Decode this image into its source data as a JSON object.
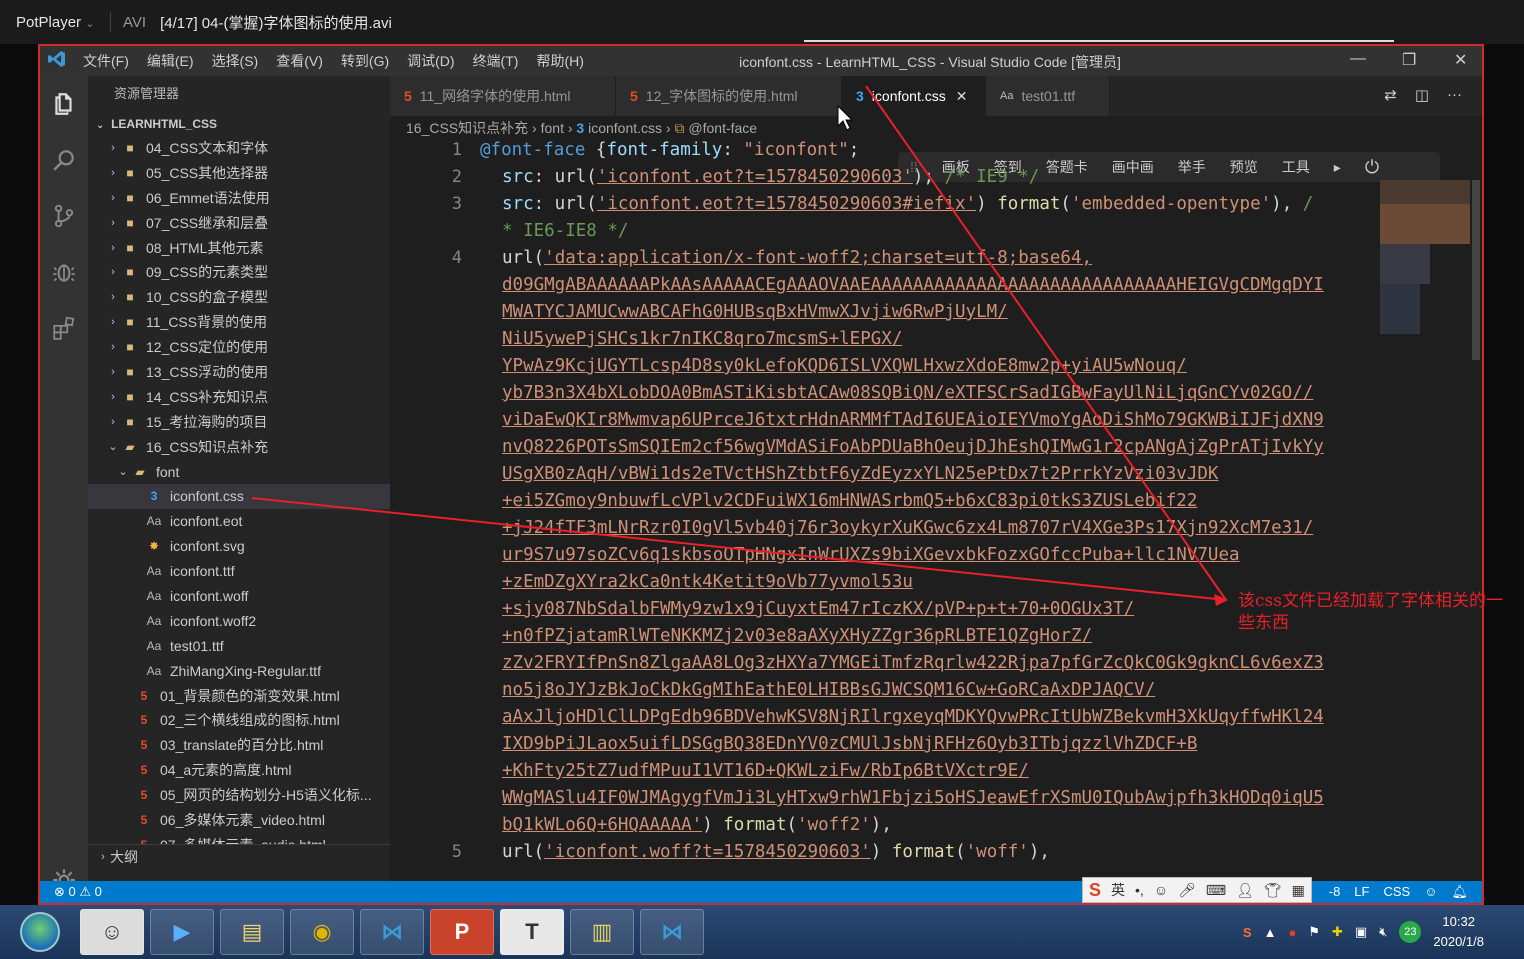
{
  "player": {
    "name": "PotPlayer",
    "format": "AVI",
    "title": "[4/17] 04-(掌握)字体图标的使用.avi"
  },
  "window": {
    "menu": [
      "文件(F)",
      "编辑(E)",
      "选择(S)",
      "查看(V)",
      "转到(G)",
      "调试(D)",
      "终端(T)",
      "帮助(H)"
    ],
    "title": "iconfont.css - LearnHTML_CSS - Visual Studio Code [管理员]"
  },
  "sidebar": {
    "header": "资源管理器",
    "section": "LEARNHTML_CSS",
    "items": [
      {
        "label": "04_CSS文本和字体",
        "type": "folder"
      },
      {
        "label": "05_CSS其他选择器",
        "type": "folder"
      },
      {
        "label": "06_Emmet语法使用",
        "type": "folder"
      },
      {
        "label": "07_CSS继承和层叠",
        "type": "folder"
      },
      {
        "label": "08_HTML其他元素",
        "type": "folder"
      },
      {
        "label": "09_CSS的元素类型",
        "type": "folder"
      },
      {
        "label": "10_CSS的盒子模型",
        "type": "folder"
      },
      {
        "label": "11_CSS背景的使用",
        "type": "folder"
      },
      {
        "label": "12_CSS定位的使用",
        "type": "folder"
      },
      {
        "label": "13_CSS浮动的使用",
        "type": "folder"
      },
      {
        "label": "14_CSS补充知识点",
        "type": "folder"
      },
      {
        "label": "15_考拉海购的项目",
        "type": "folder"
      },
      {
        "label": "16_CSS知识点补充",
        "type": "folder-open"
      },
      {
        "label": "font",
        "type": "subfolder"
      },
      {
        "label": "iconfont.css",
        "type": "css",
        "selected": true
      },
      {
        "label": "iconfont.eot",
        "type": "font"
      },
      {
        "label": "iconfont.svg",
        "type": "svg"
      },
      {
        "label": "iconfont.ttf",
        "type": "font"
      },
      {
        "label": "iconfont.woff",
        "type": "font"
      },
      {
        "label": "iconfont.woff2",
        "type": "font"
      },
      {
        "label": "test01.ttf",
        "type": "font"
      },
      {
        "label": "ZhiMangXing-Regular.ttf",
        "type": "font"
      },
      {
        "label": "01_背景颜色的渐变效果.html",
        "type": "html"
      },
      {
        "label": "02_三个横线组成的图标.html",
        "type": "html"
      },
      {
        "label": "03_translate的百分比.html",
        "type": "html"
      },
      {
        "label": "04_a元素的高度.html",
        "type": "html"
      },
      {
        "label": "05_网页的结构划分-H5语义化标...",
        "type": "html"
      },
      {
        "label": "06_多媒体元素_video.html",
        "type": "html"
      },
      {
        "label": "07_多媒体元素_audio.html",
        "type": "html"
      }
    ],
    "outline": "大纲"
  },
  "tabs": [
    {
      "label": "11_网络字体的使用.html",
      "icon": "html5-icon"
    },
    {
      "label": "12_字体图标的使用.html",
      "icon": "html5-icon"
    },
    {
      "label": "iconfont.css",
      "icon": "css3-icon",
      "active": true
    },
    {
      "label": "test01.ttf",
      "icon": "font-icon"
    }
  ],
  "breadcrumb": {
    "folder": "16_CSS知识点补充",
    "sub": "font",
    "file": "iconfont.css",
    "symbol": "@font-face"
  },
  "floating_toolbar": [
    "画板",
    "签到",
    "答题卡",
    "画中画",
    "举手",
    "预览",
    "工具"
  ],
  "code": {
    "line1": {
      "num": "1",
      "at": "@font-face",
      "brace": " {",
      "prop": "font-family",
      "colon": ": ",
      "val": "\"iconfont\"",
      "semi": ";"
    },
    "line2": {
      "num": "2",
      "prop": "src",
      "pre": ": url(",
      "str": "'iconfont.eot?t=1578450290603'",
      "post": ");",
      "cmt": " /* IE9 */"
    },
    "line3": {
      "num": "3",
      "prop": "src",
      "pre": ": url(",
      "str": "'iconfont.eot?t=1578450290603#iefix'",
      "post": ") ",
      "fn": "format",
      "fstr": "'embedded-opentype'",
      "tail": "),",
      "cmt": " /"
    },
    "line3b": "* IE6-IE8 */",
    "line4": {
      "num": "4",
      "pre": "url(",
      "str": "'data:application/x-font-woff2;charset=utf-8;base64,"
    },
    "base64": [
      "d09GMgABAAAAAAPkAAsAAAAACEgAAAOVAAEAAAAAAAAAAAAAAAAAAAAAAAAAAAAAHEIGVgCDMgqDYI",
      "MWATYCJAMUCwwABCAFhG0HUBsqBxHVmwXJvjiw6RwPjUyLM/",
      "NiU5ywePjSHCs1kr7nIKC8qro7mcsmS+lEPGX/",
      "YPwAz9KcjUGYTLcsp4D8sy0kLefoKQD6ISLVXQWLHxwzXdoE8mw2p+yiAU5wNouq/",
      "yb7B3n3X4bXLobDOA0BmASTiKisbtACAw08SQBiQN/eXTFSCrSadIGBwFayUlNiLjqGnCYv02GO//",
      "viDaEwQKIr8Mwmvap6UPrceJ6txtrHdnARMMfTAdI6UEAioIEYVmoYgAoDiShMo79GKWBiIJFjdXN9",
      "nvQ8226POTsSmSQIEm2cf56wgVMdASiFoAbPDUaBhOeujDJhEshQIMwG1r2cpANgAjZgPrATjIvkYy",
      "USgXB0zAqH/vBWi1ds2eTVctHShZtbtF6yZdEyzxYLN25ePtDx7t2PrrkYzVzi03vJDK",
      "+ei5ZGmoy9nbuwfLcVPlv2CDFuiWX16mHNWASrbmQ5+b6xC83pi0tkS3ZUSLebif22",
      "+jJ24fTF3mLNrRzr0I0gVl5vb40j76r3oykyrXuKGwc6zx4Lm8707rV4XGe3Ps17Xjn92XcM7e31/",
      "ur9S7u97soZCv6q1skbsoOTpHNgxInWrUXZs9biXGevxbkFozxGOfccPuba+llc1NV7Uea",
      "+zEmDZgXYra2kCa0ntk4Ketit9oVb77yvmol53u",
      "+sjy087NbSdalbFWMy9zw1x9jCuyxtEm47rIczKX/pVP+p+t+70+0OGUx3T/",
      "+n0fPZjatamRlWTeNKKMZj2v03e8aAXyXHyZZgr36pRLBTE1QZgHorZ/",
      "zZv2FRYIfPnSn8ZlgaAA8LOg3zHXYa7YMGEiTmfzRqrlw422Rjpa7pfGrZcQkC0Gk9gknCL6v6exZ3",
      "no5j8oJYJzBkJoCkDkGgMIhEathE0LHIBBsGJWCSQM16Cw+GoRCaAxDPJAQCV/",
      "aAxJljoHDlClLDPgEdb96BDVehwKSV8NjRIlrgxeyqMDKYQvwPRcItUbWZBekvmH3XkUqyffwHKl24",
      "IXD9bPiJLaox5uifLDSGgBQ38EDnYV0zCMUlJsbNjRFHz6Oyb3ITbjqzzlVhZDCF+B",
      "+KhFty25tZ7udfMPuuI1VT16D+QKWLziFw/RbIp6BtVXctr9E/",
      "WWgMASlu4IF0WJMAgygfVmJi3LyHTxw9rhW1Fbjzi5oHSJeawEfrXSmU0IQubAwjpfh3kHODq0iqU5",
      "bQ1kWLo6Q+6HQAAAAA'"
    ],
    "line4end": {
      "post": ") ",
      "fn": "format",
      "fstr": "'woff2'",
      "tail": "),"
    },
    "line5": {
      "num": "5",
      "pre": "url(",
      "str": "'iconfont.woff?t=1578450290603'",
      "post": ") ",
      "fn": "format",
      "fstr": "'woff'",
      "tail": "),"
    }
  },
  "statusbar": {
    "errors": "⊗ 0 ⚠ 0",
    "encoding": "-8",
    "eol": "LF",
    "lang": "CSS"
  },
  "ime": {
    "mode": "英"
  },
  "annotation": {
    "note": "该css文件已经加载了字体相关的一些东西"
  },
  "taskbar": {
    "time": "10:32",
    "date": "2020/1/8",
    "badge": "23"
  },
  "colors": {
    "accent": "#007acc",
    "annotation": "#e8202a",
    "string": "#ce9178",
    "keyword": "#569cd6"
  }
}
